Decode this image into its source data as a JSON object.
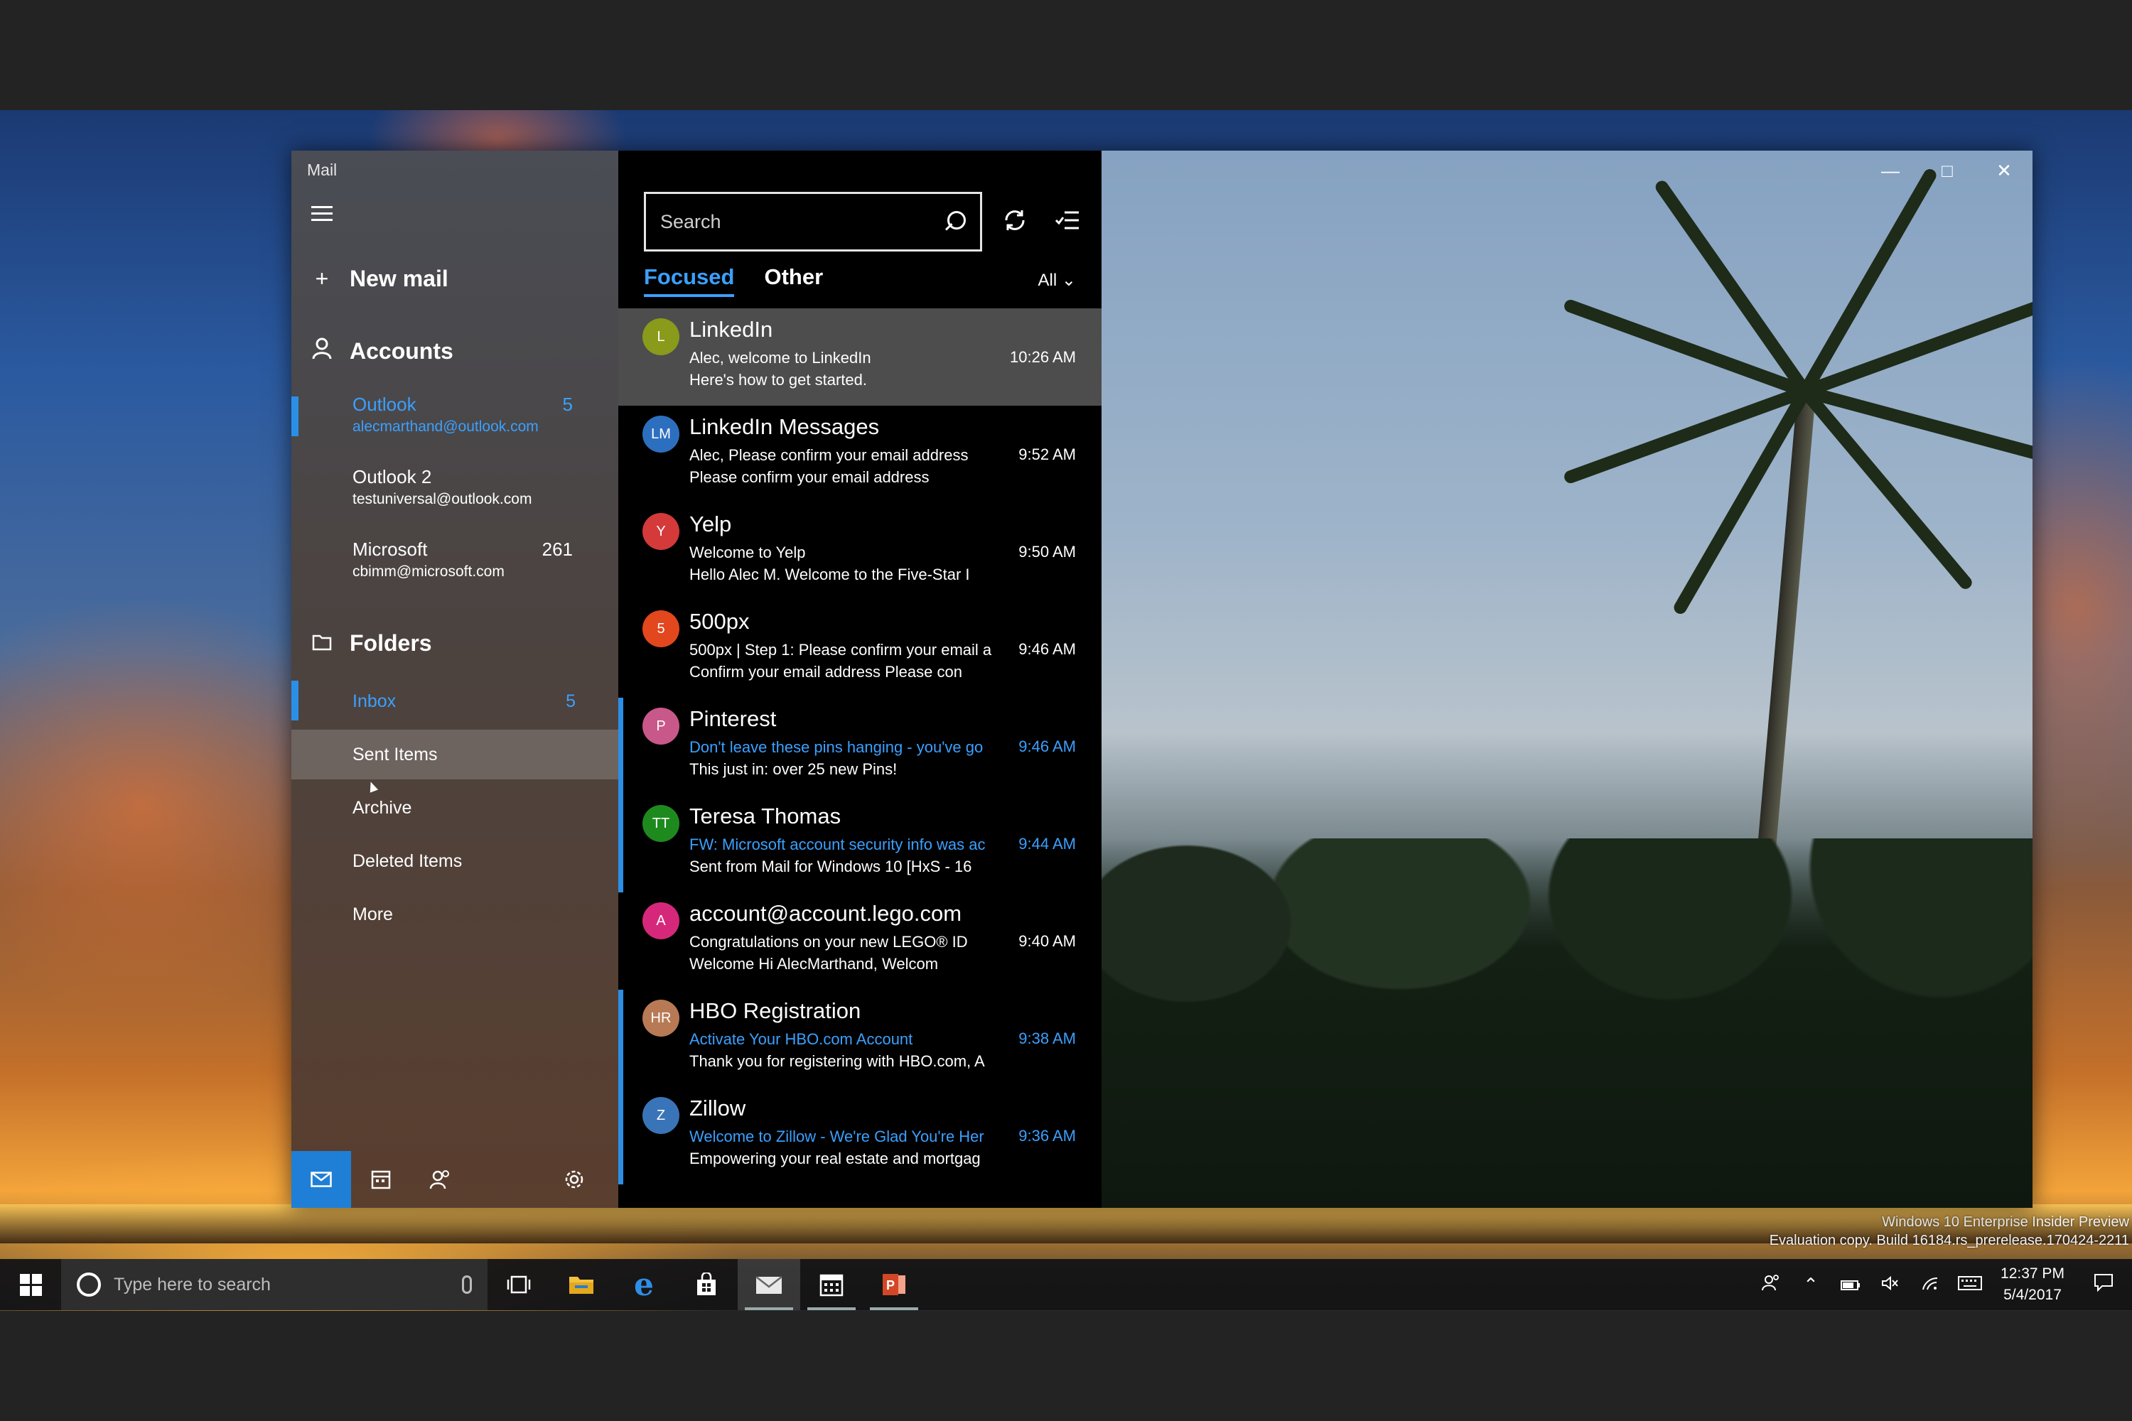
{
  "window": {
    "app_title": "Mail"
  },
  "nav": {
    "new_mail": "New mail",
    "accounts_label": "Accounts",
    "accounts": [
      {
        "name": "Outlook",
        "email": "alecmarthand@outlook.com",
        "count": "5",
        "active": true
      },
      {
        "name": "Outlook 2",
        "email": "testuniversal@outlook.com",
        "count": "",
        "active": false
      },
      {
        "name": "Microsoft",
        "email": "cbimm@microsoft.com",
        "count": "261",
        "active": false
      }
    ],
    "folders_label": "Folders",
    "folders": [
      {
        "label": "Inbox",
        "count": "5",
        "state": "active"
      },
      {
        "label": "Sent Items",
        "count": "",
        "state": "hover"
      },
      {
        "label": "Archive",
        "count": "",
        "state": ""
      },
      {
        "label": "Deleted Items",
        "count": "",
        "state": ""
      },
      {
        "label": "More",
        "count": "",
        "state": ""
      }
    ],
    "bottom_icons": [
      "mail-icon",
      "calendar-icon",
      "people-icon",
      "settings-icon"
    ]
  },
  "list": {
    "search_placeholder": "Search",
    "tabs": [
      "Focused",
      "Other"
    ],
    "filter_label": "All",
    "messages": [
      {
        "initials": "L",
        "avatar_color": "#8a9a1a",
        "sender": "LinkedIn",
        "subject": "Alec, welcome to LinkedIn",
        "preview": "Here's how to get started.",
        "time": "10:26 AM",
        "unread": false,
        "selected": true
      },
      {
        "initials": "LM",
        "avatar_color": "#2d6fbf",
        "sender": "LinkedIn Messages",
        "subject": "Alec, Please confirm your email address",
        "preview": "Please confirm your email address",
        "time": "9:52 AM",
        "unread": false,
        "selected": false
      },
      {
        "initials": "Y",
        "avatar_color": "#d43a3a",
        "sender": "Yelp",
        "subject": "Welcome to Yelp",
        "preview": "Hello Alec M.   Welcome to the Five-Star I",
        "time": "9:50 AM",
        "unread": false,
        "selected": false
      },
      {
        "initials": "5",
        "avatar_color": "#e2471d",
        "sender": "500px",
        "subject": "500px | Step 1: Please confirm your email a",
        "preview": "Confirm your email address     Please con",
        "time": "9:46 AM",
        "unread": false,
        "selected": false
      },
      {
        "initials": "P",
        "avatar_color": "#c9588a",
        "sender": "Pinterest",
        "subject": "Don't leave these pins hanging - you've go",
        "preview": "This just in: over 25 new Pins!",
        "time": "9:46 AM",
        "unread": true,
        "selected": false
      },
      {
        "initials": "TT",
        "avatar_color": "#1e8a1e",
        "sender": "Teresa Thomas",
        "subject": "FW: Microsoft account security info was ac",
        "preview": "Sent from Mail for Windows 10  [HxS - 16",
        "time": "9:44 AM",
        "unread": true,
        "selected": false
      },
      {
        "initials": "A",
        "avatar_color": "#d6287a",
        "sender": "account@account.lego.com",
        "subject": "Congratulations on your new LEGO® ID",
        "preview": "Welcome      Hi AlecMarthand,     Welcom",
        "time": "9:40 AM",
        "unread": false,
        "selected": false
      },
      {
        "initials": "HR",
        "avatar_color": "#b77a55",
        "sender": "HBO Registration",
        "subject": "Activate Your HBO.com Account",
        "preview": "Thank you for registering with HBO.com, A",
        "time": "9:38 AM",
        "unread": true,
        "selected": false
      },
      {
        "initials": "Z",
        "avatar_color": "#3a74b8",
        "sender": "Zillow",
        "subject": "Welcome to Zillow - We're Glad You're Her",
        "preview": "Empowering your real estate and mortgag",
        "time": "9:36 AM",
        "unread": true,
        "selected": false
      }
    ]
  },
  "desktop": {
    "watermark_line1": "Windows 10 Enterprise Insider Preview",
    "watermark_line2": "Evaluation copy. Build 16184.rs_prerelease.170424-2211"
  },
  "taskbar": {
    "search_placeholder": "Type here to search",
    "time": "12:37 PM",
    "date": "5/4/2017",
    "apps": [
      "task-view-icon",
      "file-explorer-icon",
      "edge-icon",
      "store-icon",
      "mail-icon",
      "calendar-icon",
      "powerpoint-icon"
    ]
  }
}
